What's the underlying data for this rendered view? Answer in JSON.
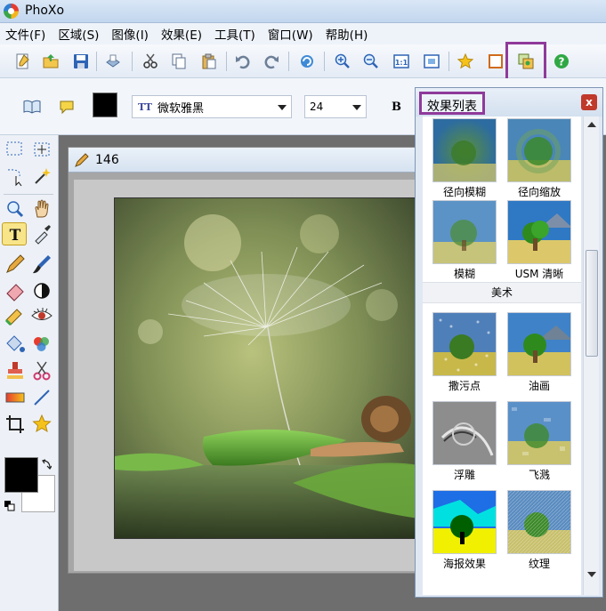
{
  "app": {
    "title": "PhoXo"
  },
  "menu": [
    "文件(F)",
    "区域(S)",
    "图像(I)",
    "效果(E)",
    "工具(T)",
    "窗口(W)",
    "帮助(H)"
  ],
  "toolbar": {
    "buttons": [
      "new-icon",
      "open-icon",
      "save-icon",
      "scan-icon",
      "cut-icon",
      "copy-icon",
      "paste-icon",
      "undo-icon",
      "redo-icon",
      "refresh-icon",
      "zoom-in-icon",
      "zoom-out-icon",
      "actual-size-icon",
      "fit-window-icon",
      "star-icon",
      "frame-icon",
      "effects-list-icon",
      "help-icon"
    ],
    "actual_size_label": "1:1"
  },
  "options": {
    "font": "微软雅黑",
    "size": "24",
    "bold_label": "B"
  },
  "document": {
    "title": "146"
  },
  "effects_panel": {
    "title": "效果列表",
    "close_label": "x",
    "items": [
      {
        "label": "径向模糊"
      },
      {
        "label": "径向缩放"
      },
      {
        "label": "模糊"
      },
      {
        "label": "USM 清晰"
      }
    ],
    "section": "美术",
    "art_items": [
      {
        "label": "撒污点"
      },
      {
        "label": "油画"
      },
      {
        "label": "浮雕"
      },
      {
        "label": "飞溅"
      },
      {
        "label": "海报效果"
      },
      {
        "label": "纹理"
      }
    ]
  },
  "colors": {
    "highlight": "#8f3a9a",
    "foreground": "#000000",
    "background": "#ffffff"
  }
}
